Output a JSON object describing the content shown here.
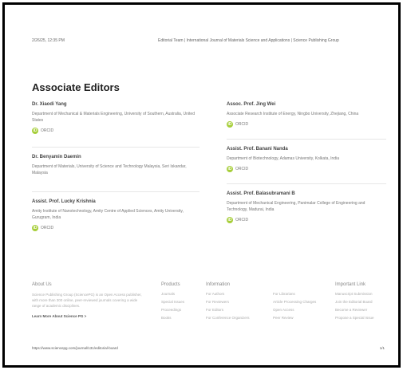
{
  "header": {
    "datetime": "2/26/25, 12:35 PM",
    "source": "Editorial Team | International Journal of Materials Science and Applications | Science Publishing Group"
  },
  "page": {
    "title": "Associate Editors"
  },
  "editors": [
    {
      "name": "Dr. Xiaodi Yang",
      "affiliation": "Department of Mechanical & Materials Engineering, University of Southern, Australia, United States",
      "orcid": "ORCID"
    },
    {
      "name": "Assoc. Prof. Jing Wei",
      "affiliation": "Associate Research Institute of Energy, Ningbo University, Zhejiang, China",
      "orcid": "ORCID"
    },
    {
      "name": "Dr. Benyamin Daemin",
      "affiliation": "Department of Materials, University of Science and Technology Malaysia, Seri Iskandar, Malaysia",
      "orcid": "ORCID"
    },
    {
      "name": "Assist. Prof. Banani Nanda",
      "affiliation": "Department of Biotechnology, Adamas University, Kolkata, India",
      "orcid": "ORCID"
    },
    {
      "name": "Assist. Prof. Lucky Krishnia",
      "affiliation": "Amity Institute of Nanotechnology, Amity Centre of Applied Sciences, Amity University, Gurugram, India",
      "orcid": "ORCID"
    },
    {
      "name": "Assist. Prof. Balasubramani B",
      "affiliation": "Department of Mechanical Engineering, Panimalar College of Engineering and Technology, Madurai, India",
      "orcid": "ORCID"
    }
  ],
  "footer": {
    "about_heading": "About Us",
    "about_text": "Science Publishing Group (SciencePG) is an Open Access publisher, with more than 300 online, peer-reviewed journals covering a wide range of academic disciplines.",
    "learn_more": "Learn More About Science PG >",
    "products_heading": "Products",
    "products": [
      "Journals",
      "Special Issues",
      "Proceedings",
      "Books"
    ],
    "information_heading": "Information",
    "information_col1": [
      "For Authors",
      "For Reviewers",
      "For Editors",
      "For Conference Organizers"
    ],
    "information_col2": [
      "For Librarians",
      "Article Processing Charges",
      "Open Access",
      "Peer Review"
    ],
    "links_heading": "Important Link",
    "links": [
      "Manuscript Submission",
      "Join the Editorial Board",
      "Become a Reviewer",
      "Propose a Special Issue"
    ]
  },
  "bottom": {
    "url": "https://www.sciencepg.com/journal/131/editorial-board",
    "page": "1/1"
  }
}
